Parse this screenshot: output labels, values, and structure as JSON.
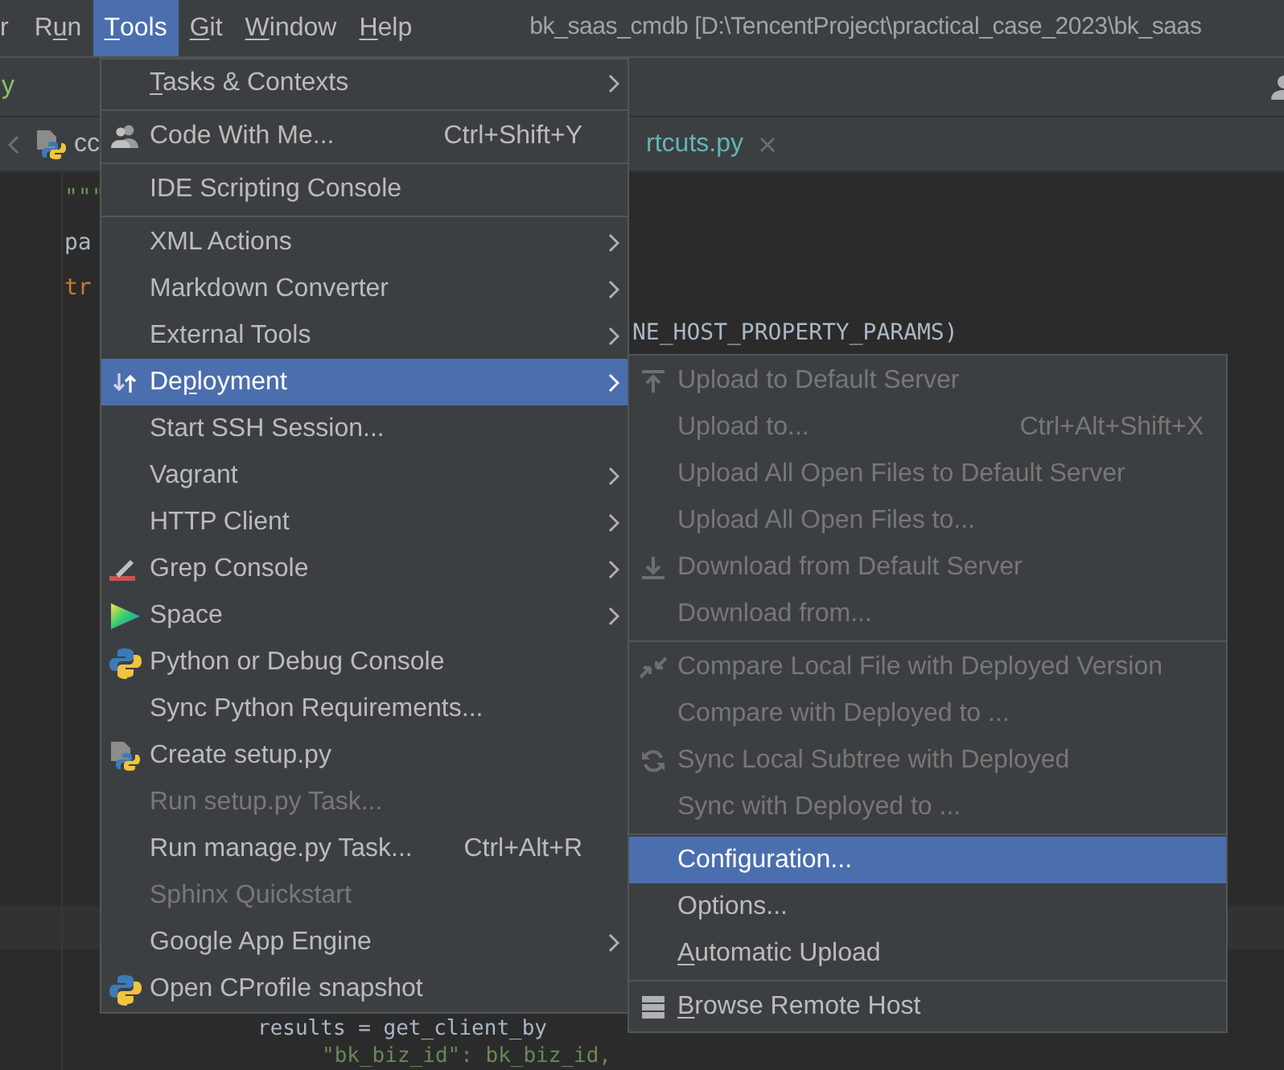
{
  "menubar": {
    "items": [
      {
        "label": "r",
        "selected": false
      },
      {
        "label": "Run",
        "selected": false
      },
      {
        "label": "Tools",
        "selected": true
      },
      {
        "label": "Git",
        "selected": false
      },
      {
        "label": "Window",
        "selected": false
      },
      {
        "label": "Help",
        "selected": false
      }
    ],
    "window_title": "bk_saas_cmdb [D:\\TencentProject\\practical_case_2023\\bk_saas"
  },
  "toolbar": {
    "text": "y"
  },
  "tabs": [
    {
      "label": "cc",
      "selected": false
    },
    {
      "label": "rtcuts.py",
      "selected": true
    }
  ],
  "editor": {
    "top_lines": [
      {
        "text": "\"\"\"",
        "kind": "doc"
      },
      {
        "text": "pa",
        "kind": "plain"
      },
      {
        "text": "tr",
        "kind": "keyword"
      },
      {
        "text": "NE_HOST_PROPERTY_PARAMS)",
        "kind": "tail"
      }
    ],
    "bottom_lines": [
      {
        "text": "results = get_client_by",
        "kind": "indent3"
      },
      {
        "text": "\"bk_biz_id\": bk_biz_id,",
        "kind": "indent4"
      }
    ]
  },
  "tools_menu": {
    "items": [
      {
        "kind": "item",
        "label": "Tasks & Contexts",
        "submenu": true,
        "disabled": false,
        "selected": false
      },
      {
        "kind": "separator"
      },
      {
        "kind": "item",
        "label": "Code With Me...",
        "shortcut": "Ctrl+Shift+Y",
        "submenu": false,
        "disabled": false,
        "selected": false
      },
      {
        "kind": "separator"
      },
      {
        "kind": "item",
        "label": "IDE Scripting Console",
        "submenu": false,
        "disabled": false,
        "selected": false
      },
      {
        "kind": "separator"
      },
      {
        "kind": "item",
        "label": "XML Actions",
        "submenu": true,
        "disabled": false,
        "selected": false
      },
      {
        "kind": "item",
        "label": "Markdown Converter",
        "submenu": true,
        "disabled": false,
        "selected": false
      },
      {
        "kind": "item",
        "label": "External Tools",
        "submenu": true,
        "disabled": false,
        "selected": false
      },
      {
        "kind": "item",
        "label": "Deployment",
        "submenu": true,
        "disabled": false,
        "selected": true
      },
      {
        "kind": "item",
        "label": "Start SSH Session...",
        "submenu": false,
        "disabled": false,
        "selected": false
      },
      {
        "kind": "item",
        "label": "Vagrant",
        "submenu": true,
        "disabled": false,
        "selected": false
      },
      {
        "kind": "item",
        "label": "HTTP Client",
        "submenu": true,
        "disabled": false,
        "selected": false
      },
      {
        "kind": "item",
        "label": "Grep Console",
        "submenu": true,
        "disabled": false,
        "selected": false
      },
      {
        "kind": "item",
        "label": "Space",
        "submenu": true,
        "disabled": false,
        "selected": false
      },
      {
        "kind": "item",
        "label": "Python or Debug Console",
        "submenu": false,
        "disabled": false,
        "selected": false
      },
      {
        "kind": "item",
        "label": "Sync Python Requirements...",
        "submenu": false,
        "disabled": false,
        "selected": false
      },
      {
        "kind": "item",
        "label": "Create setup.py",
        "submenu": false,
        "disabled": false,
        "selected": false
      },
      {
        "kind": "item",
        "label": "Run setup.py Task...",
        "submenu": false,
        "disabled": true,
        "selected": false
      },
      {
        "kind": "item",
        "label": "Run manage.py Task...",
        "shortcut": "Ctrl+Alt+R",
        "submenu": false,
        "disabled": false,
        "selected": false
      },
      {
        "kind": "item",
        "label": "Sphinx Quickstart",
        "submenu": false,
        "disabled": true,
        "selected": false
      },
      {
        "kind": "item",
        "label": "Google App Engine",
        "submenu": true,
        "disabled": false,
        "selected": false
      },
      {
        "kind": "item",
        "label": "Open CProfile snapshot",
        "submenu": false,
        "disabled": false,
        "selected": false
      }
    ]
  },
  "deployment_menu": {
    "items": [
      {
        "kind": "item",
        "label": "Upload to Default Server",
        "disabled": true,
        "selected": false
      },
      {
        "kind": "item",
        "label": "Upload to...",
        "shortcut": "Ctrl+Alt+Shift+X",
        "disabled": true,
        "selected": false
      },
      {
        "kind": "item",
        "label": "Upload All Open Files to Default Server",
        "disabled": true,
        "selected": false
      },
      {
        "kind": "item",
        "label": "Upload All Open Files to...",
        "disabled": true,
        "selected": false
      },
      {
        "kind": "item",
        "label": "Download from Default Server",
        "disabled": true,
        "selected": false
      },
      {
        "kind": "item",
        "label": "Download from...",
        "disabled": true,
        "selected": false
      },
      {
        "kind": "separator"
      },
      {
        "kind": "item",
        "label": "Compare Local File with Deployed Version",
        "disabled": true,
        "selected": false
      },
      {
        "kind": "item",
        "label": "Compare with Deployed to ...",
        "disabled": true,
        "selected": false
      },
      {
        "kind": "item",
        "label": "Sync Local Subtree with Deployed",
        "disabled": true,
        "selected": false
      },
      {
        "kind": "item",
        "label": "Sync with Deployed to ...",
        "disabled": true,
        "selected": false
      },
      {
        "kind": "separator"
      },
      {
        "kind": "item",
        "label": "Configuration...",
        "disabled": false,
        "selected": true
      },
      {
        "kind": "item",
        "label": "Options...",
        "disabled": false,
        "selected": false
      },
      {
        "kind": "item",
        "label": "Automatic Upload",
        "disabled": false,
        "selected": false
      },
      {
        "kind": "separator"
      },
      {
        "kind": "item",
        "label": "Browse Remote Host",
        "disabled": false,
        "selected": false
      }
    ]
  }
}
